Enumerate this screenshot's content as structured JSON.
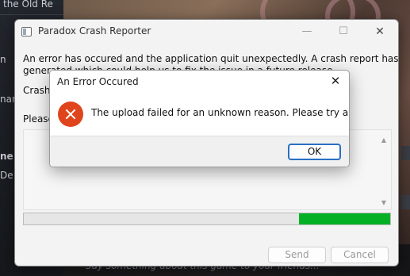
{
  "background": {
    "sidebar_texts": [
      "the Old Re",
      "n",
      "nar",
      "ne",
      "De"
    ],
    "chat_hint": "Say something about this game to your friends..."
  },
  "crash_reporter": {
    "title": "Paradox Crash Reporter",
    "caption": {
      "minimize": "—",
      "maximize": "☐",
      "close": "✕"
    },
    "message_line1": "An error has occured and the application quit unexpectedly. A crash report has been",
    "message_line2": "generated which could help us to fix the issue in a future release.",
    "label_crash": "Crash",
    "label_please": "Please",
    "scroll_up": "▲",
    "scroll_down": "▼",
    "progress_filled_range": [
      0.75,
      1.0
    ],
    "progress_color": "#06b025",
    "buttons": {
      "send": "Send",
      "cancel": "Cancel"
    }
  },
  "error_dialog": {
    "title": "An Error Occured",
    "close": "✕",
    "icon": "error-x-icon",
    "icon_color": "#e0441c",
    "message": "The upload failed for an unknown reason. Please try again.",
    "ok": "OK"
  }
}
